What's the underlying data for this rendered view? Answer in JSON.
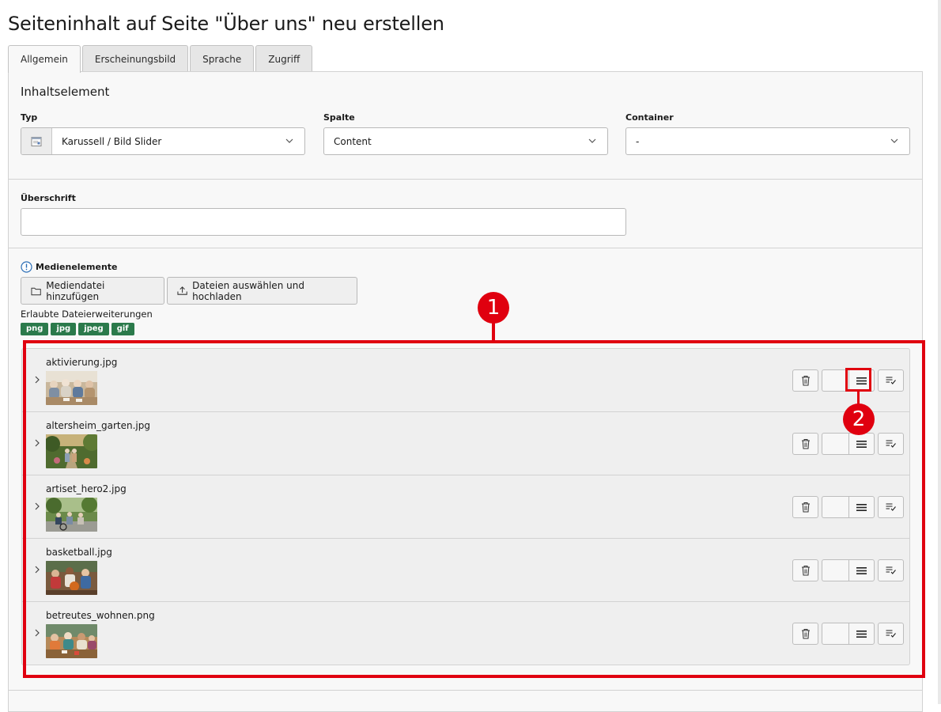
{
  "page": {
    "title": "Seiteninhalt auf Seite \"Über uns\" neu erstellen"
  },
  "tabs": [
    {
      "label": "Allgemein",
      "active": true
    },
    {
      "label": "Erscheinungsbild",
      "active": false
    },
    {
      "label": "Sprache",
      "active": false
    },
    {
      "label": "Zugriff",
      "active": false
    }
  ],
  "content_element": {
    "section_title": "Inhaltselement",
    "type": {
      "label": "Typ",
      "value": "Karussell / Bild Slider",
      "icon": "content-element-icon"
    },
    "column": {
      "label": "Spalte",
      "value": "Content"
    },
    "container": {
      "label": "Container",
      "value": "-"
    }
  },
  "header": {
    "label": "Überschrift",
    "value": ""
  },
  "media": {
    "label": "Medienelemente",
    "add_media_button": "Mediendatei hinzufügen",
    "upload_button": "Dateien auswählen und hochladen",
    "allowed_label": "Erlaubte Dateierweiterungen",
    "allowed_extensions": [
      "png",
      "jpg",
      "jpeg",
      "gif"
    ],
    "files": [
      {
        "name": "aktivierung.jpg"
      },
      {
        "name": "altersheim_garten.jpg"
      },
      {
        "name": "artiset_hero2.jpg"
      },
      {
        "name": "basketball.jpg"
      },
      {
        "name": "betreutes_wohnen.png"
      }
    ]
  },
  "annotations": {
    "marker_1": "1",
    "marker_2": "2",
    "color": "#e0000f"
  },
  "colors": {
    "badge_green": "#2b7a4b",
    "panel_bg": "#f8f8f8",
    "border": "#d2d2d2"
  }
}
